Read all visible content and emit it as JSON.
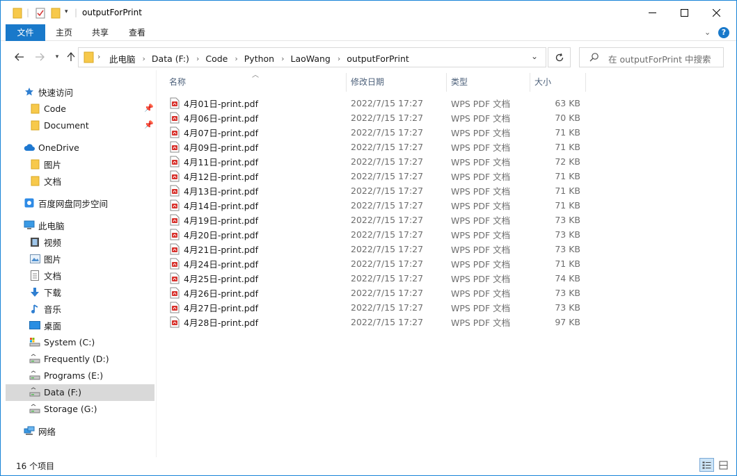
{
  "window": {
    "title": "outputForPrint",
    "accent": "#1979ca"
  },
  "ribbon": {
    "tabs": [
      "文件",
      "主页",
      "共享",
      "查看"
    ]
  },
  "address": {
    "crumbs": [
      "此电脑",
      "Data (F:)",
      "Code",
      "Python",
      "LaoWang",
      "outputForPrint"
    ]
  },
  "search": {
    "placeholder": "在 outputForPrint 中搜索"
  },
  "sidebar": {
    "quick_access": "快速访问",
    "quick_items": [
      "Code",
      "Document"
    ],
    "onedrive": "OneDrive",
    "onedrive_items": [
      "图片",
      "文档"
    ],
    "baidu": "百度网盘同步空间",
    "this_pc": "此电脑",
    "pc_items": [
      "视频",
      "图片",
      "文档",
      "下载",
      "音乐",
      "桌面"
    ],
    "drives": [
      "System (C:)",
      "Frequently (D:)",
      "Programs (E:)",
      "Data (F:)",
      "Storage (G:)"
    ],
    "network": "网络"
  },
  "columns": {
    "name": "名称",
    "date": "修改日期",
    "type": "类型",
    "size": "大小"
  },
  "files": [
    {
      "name": "4月01日-print.pdf",
      "date": "2022/7/15 17:27",
      "type": "WPS PDF 文档",
      "size": "63 KB"
    },
    {
      "name": "4月06日-print.pdf",
      "date": "2022/7/15 17:27",
      "type": "WPS PDF 文档",
      "size": "70 KB"
    },
    {
      "name": "4月07日-print.pdf",
      "date": "2022/7/15 17:27",
      "type": "WPS PDF 文档",
      "size": "71 KB"
    },
    {
      "name": "4月09日-print.pdf",
      "date": "2022/7/15 17:27",
      "type": "WPS PDF 文档",
      "size": "71 KB"
    },
    {
      "name": "4月11日-print.pdf",
      "date": "2022/7/15 17:27",
      "type": "WPS PDF 文档",
      "size": "72 KB"
    },
    {
      "name": "4月12日-print.pdf",
      "date": "2022/7/15 17:27",
      "type": "WPS PDF 文档",
      "size": "71 KB"
    },
    {
      "name": "4月13日-print.pdf",
      "date": "2022/7/15 17:27",
      "type": "WPS PDF 文档",
      "size": "71 KB"
    },
    {
      "name": "4月14日-print.pdf",
      "date": "2022/7/15 17:27",
      "type": "WPS PDF 文档",
      "size": "71 KB"
    },
    {
      "name": "4月19日-print.pdf",
      "date": "2022/7/15 17:27",
      "type": "WPS PDF 文档",
      "size": "73 KB"
    },
    {
      "name": "4月20日-print.pdf",
      "date": "2022/7/15 17:27",
      "type": "WPS PDF 文档",
      "size": "73 KB"
    },
    {
      "name": "4月21日-print.pdf",
      "date": "2022/7/15 17:27",
      "type": "WPS PDF 文档",
      "size": "73 KB"
    },
    {
      "name": "4月24日-print.pdf",
      "date": "2022/7/15 17:27",
      "type": "WPS PDF 文档",
      "size": "71 KB"
    },
    {
      "name": "4月25日-print.pdf",
      "date": "2022/7/15 17:27",
      "type": "WPS PDF 文档",
      "size": "74 KB"
    },
    {
      "name": "4月26日-print.pdf",
      "date": "2022/7/15 17:27",
      "type": "WPS PDF 文档",
      "size": "73 KB"
    },
    {
      "name": "4月27日-print.pdf",
      "date": "2022/7/15 17:27",
      "type": "WPS PDF 文档",
      "size": "73 KB"
    },
    {
      "name": "4月28日-print.pdf",
      "date": "2022/7/15 17:27",
      "type": "WPS PDF 文档",
      "size": "97 KB"
    }
  ],
  "status": {
    "count": "16 个项目"
  }
}
